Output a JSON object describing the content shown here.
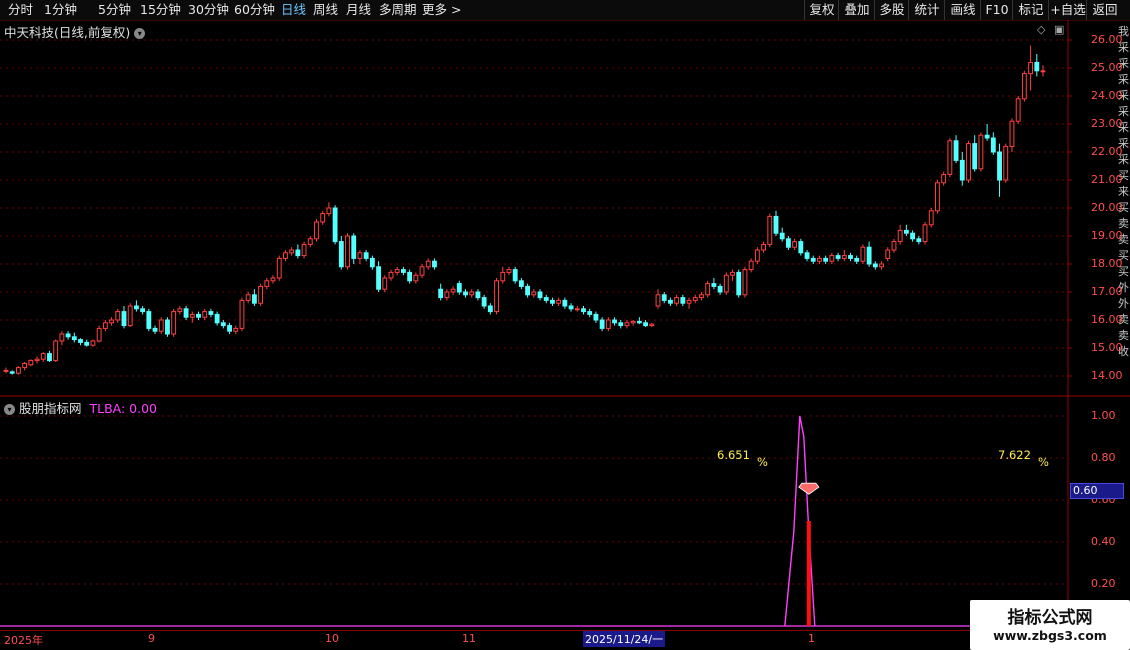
{
  "toolbar": {
    "periods": [
      "分时",
      "1分钟",
      "5分钟",
      "15分钟",
      "30分钟",
      "60分钟",
      "日线",
      "周线",
      "月线",
      "多周期",
      "更多"
    ],
    "active_period": "日线",
    "right_buttons": [
      "复权",
      "叠加",
      "多股",
      "统计",
      "画线",
      "F10",
      "标记",
      "+自选",
      "返回"
    ]
  },
  "main_chart": {
    "title": "中天科技(日线,前复权)",
    "up_color": "#ff4040",
    "down_color": "#54ffff",
    "y_ticks": [
      "26.00",
      "25.00",
      "24.00",
      "23.00",
      "22.00",
      "21.00",
      "20.00",
      "19.00",
      "18.00",
      "17.00",
      "16.00",
      "15.00",
      "14.00"
    ],
    "right_edge_text": "我采采采采采采采采买来买卖卖买买外外卖卖收"
  },
  "indicator": {
    "name": "股朋指标网",
    "value_label": "TLBA: 0.00",
    "y_ticks": [
      "1.00",
      "0.80",
      "0.60",
      "0.40",
      "0.20"
    ],
    "current_value": "0.60",
    "signals": [
      {
        "date_index": 128,
        "pct": "6.651"
      },
      {
        "date_index": 190,
        "pct": "7.622"
      }
    ],
    "pct_symbol": "%",
    "line_color": "#ff40ff",
    "bar_color": "#ff1010"
  },
  "x_axis": {
    "labels": [
      "2025年",
      "9",
      "10",
      "11",
      "2025/11/24/一",
      "1"
    ],
    "cursor_label": "2025/11/24/一"
  },
  "watermark": {
    "line1": "指标公式网",
    "line2": "www.zbgs3.com"
  },
  "chart_data": {
    "type": "candlestick",
    "y_range": [
      13.6,
      26.4
    ],
    "candles": [
      [
        14.2,
        14.3,
        14.1,
        14.2
      ],
      [
        14.15,
        14.2,
        14.05,
        14.1
      ],
      [
        14.1,
        14.35,
        14.05,
        14.3
      ],
      [
        14.3,
        14.5,
        14.2,
        14.45
      ],
      [
        14.4,
        14.6,
        14.35,
        14.55
      ],
      [
        14.55,
        14.7,
        14.45,
        14.6
      ],
      [
        14.6,
        14.85,
        14.5,
        14.8
      ],
      [
        14.8,
        14.9,
        14.5,
        14.55
      ],
      [
        14.55,
        15.3,
        14.5,
        15.25
      ],
      [
        15.25,
        15.6,
        15.1,
        15.5
      ],
      [
        15.5,
        15.6,
        15.3,
        15.4
      ],
      [
        15.4,
        15.55,
        15.2,
        15.3
      ],
      [
        15.3,
        15.35,
        15.1,
        15.2
      ],
      [
        15.2,
        15.3,
        15.05,
        15.1
      ],
      [
        15.1,
        15.3,
        15.05,
        15.25
      ],
      [
        15.25,
        15.8,
        15.2,
        15.7
      ],
      [
        15.7,
        16.0,
        15.6,
        15.9
      ],
      [
        15.9,
        16.1,
        15.8,
        16.0
      ],
      [
        16.0,
        16.4,
        15.9,
        16.3
      ],
      [
        16.3,
        16.5,
        15.7,
        15.8
      ],
      [
        15.8,
        16.6,
        15.75,
        16.5
      ],
      [
        16.5,
        16.7,
        16.3,
        16.4
      ],
      [
        16.4,
        16.5,
        16.2,
        16.3
      ],
      [
        16.3,
        16.4,
        15.6,
        15.7
      ],
      [
        15.7,
        15.8,
        15.5,
        15.6
      ],
      [
        15.6,
        16.1,
        15.5,
        16.0
      ],
      [
        16.0,
        16.1,
        15.4,
        15.5
      ],
      [
        15.5,
        16.4,
        15.4,
        16.3
      ],
      [
        16.3,
        16.5,
        16.2,
        16.4
      ],
      [
        16.4,
        16.5,
        16.0,
        16.1
      ],
      [
        16.1,
        16.3,
        15.9,
        16.2
      ],
      [
        16.2,
        16.3,
        16.0,
        16.1
      ],
      [
        16.1,
        16.4,
        16.0,
        16.3
      ],
      [
        16.3,
        16.4,
        16.1,
        16.2
      ],
      [
        16.2,
        16.3,
        15.8,
        15.9
      ],
      [
        15.9,
        16.0,
        15.7,
        15.8
      ],
      [
        15.8,
        15.9,
        15.5,
        15.6
      ],
      [
        15.6,
        15.8,
        15.5,
        15.7
      ],
      [
        15.7,
        16.8,
        15.6,
        16.7
      ],
      [
        16.7,
        17.0,
        16.6,
        16.9
      ],
      [
        16.9,
        17.1,
        16.5,
        16.6
      ],
      [
        16.6,
        17.3,
        16.5,
        17.2
      ],
      [
        17.2,
        17.5,
        17.1,
        17.4
      ],
      [
        17.4,
        17.6,
        17.3,
        17.5
      ],
      [
        17.5,
        18.3,
        17.4,
        18.2
      ],
      [
        18.2,
        18.5,
        18.1,
        18.4
      ],
      [
        18.4,
        18.6,
        18.3,
        18.5
      ],
      [
        18.5,
        18.7,
        18.2,
        18.3
      ],
      [
        18.3,
        18.8,
        18.2,
        18.7
      ],
      [
        18.7,
        19.0,
        18.6,
        18.9
      ],
      [
        18.9,
        19.6,
        18.8,
        19.5
      ],
      [
        19.5,
        19.9,
        19.4,
        19.8
      ],
      [
        19.8,
        20.2,
        19.7,
        20.0
      ],
      [
        20.0,
        20.1,
        18.7,
        18.8
      ],
      [
        18.8,
        19.0,
        17.8,
        17.9
      ],
      [
        17.9,
        19.1,
        17.8,
        19.0
      ],
      [
        19.0,
        19.1,
        18.0,
        18.2
      ],
      [
        18.2,
        18.5,
        18.0,
        18.4
      ],
      [
        18.4,
        18.5,
        18.1,
        18.2
      ],
      [
        18.2,
        18.3,
        17.8,
        17.9
      ],
      [
        17.9,
        18.1,
        17.0,
        17.1
      ],
      [
        17.1,
        17.6,
        17.0,
        17.5
      ],
      [
        17.5,
        17.8,
        17.4,
        17.7
      ],
      [
        17.7,
        17.9,
        17.6,
        17.8
      ],
      [
        17.8,
        17.9,
        17.6,
        17.7
      ],
      [
        17.7,
        17.8,
        17.3,
        17.4
      ],
      [
        17.4,
        17.7,
        17.3,
        17.6
      ],
      [
        17.6,
        18.0,
        17.5,
        17.9
      ],
      [
        17.9,
        18.2,
        17.8,
        18.1
      ],
      [
        18.1,
        18.2,
        17.8,
        17.9
      ],
      [
        17.1,
        17.3,
        16.7,
        16.8
      ],
      [
        16.8,
        17.1,
        16.7,
        17.0
      ],
      [
        17.0,
        17.2,
        16.9,
        17.1
      ],
      [
        17.3,
        17.4,
        16.9,
        17.0
      ],
      [
        17.0,
        17.1,
        16.8,
        16.9
      ],
      [
        16.9,
        17.1,
        16.8,
        17.0
      ],
      [
        17.0,
        17.1,
        16.7,
        16.8
      ],
      [
        16.8,
        16.9,
        16.4,
        16.5
      ],
      [
        16.5,
        16.6,
        16.2,
        16.3
      ],
      [
        16.3,
        17.5,
        16.2,
        17.4
      ],
      [
        17.4,
        17.9,
        17.3,
        17.7
      ],
      [
        17.7,
        17.9,
        17.6,
        17.8
      ],
      [
        17.8,
        17.9,
        17.3,
        17.4
      ],
      [
        17.4,
        17.5,
        17.1,
        17.2
      ],
      [
        17.2,
        17.3,
        16.8,
        16.9
      ],
      [
        16.9,
        17.1,
        16.8,
        17.0
      ],
      [
        17.0,
        17.1,
        16.7,
        16.8
      ],
      [
        16.8,
        16.9,
        16.6,
        16.7
      ],
      [
        16.7,
        16.8,
        16.5,
        16.6
      ],
      [
        16.6,
        16.8,
        16.5,
        16.7
      ],
      [
        16.7,
        16.8,
        16.4,
        16.5
      ],
      [
        16.5,
        16.6,
        16.3,
        16.4
      ],
      [
        16.4,
        16.5,
        16.3,
        16.4
      ],
      [
        16.4,
        16.5,
        16.2,
        16.3
      ],
      [
        16.3,
        16.4,
        16.1,
        16.2
      ],
      [
        16.2,
        16.3,
        15.9,
        16.0
      ],
      [
        16.0,
        16.1,
        15.6,
        15.7
      ],
      [
        15.7,
        16.1,
        15.6,
        16.0
      ],
      [
        16.0,
        16.1,
        15.8,
        15.9
      ],
      [
        15.9,
        16.0,
        15.7,
        15.8
      ],
      [
        15.8,
        16.0,
        15.7,
        15.9
      ],
      [
        15.9,
        16.0,
        15.8,
        15.95
      ],
      [
        15.95,
        16.1,
        15.85,
        15.9
      ],
      [
        15.9,
        16.0,
        15.75,
        15.8
      ],
      [
        15.8,
        15.9,
        15.75,
        15.85
      ],
      [
        16.5,
        17.1,
        16.4,
        16.9
      ],
      [
        16.9,
        17.0,
        16.6,
        16.7
      ],
      [
        16.7,
        16.8,
        16.5,
        16.6
      ],
      [
        16.6,
        16.9,
        16.5,
        16.8
      ],
      [
        16.8,
        16.9,
        16.5,
        16.6
      ],
      [
        16.6,
        16.8,
        16.4,
        16.7
      ],
      [
        16.7,
        16.9,
        16.6,
        16.8
      ],
      [
        16.8,
        17.0,
        16.7,
        16.9
      ],
      [
        16.9,
        17.4,
        16.8,
        17.3
      ],
      [
        17.3,
        17.5,
        17.1,
        17.2
      ],
      [
        17.2,
        17.3,
        16.9,
        17.0
      ],
      [
        17.0,
        17.7,
        16.9,
        17.6
      ],
      [
        17.6,
        17.8,
        17.4,
        17.7
      ],
      [
        17.7,
        17.8,
        16.8,
        16.9
      ],
      [
        16.9,
        17.9,
        16.8,
        17.8
      ],
      [
        17.8,
        18.2,
        17.7,
        18.1
      ],
      [
        18.1,
        18.6,
        18.0,
        18.5
      ],
      [
        18.5,
        18.8,
        18.4,
        18.7
      ],
      [
        18.7,
        19.8,
        18.6,
        19.7
      ],
      [
        19.7,
        19.9,
        19.0,
        19.1
      ],
      [
        19.1,
        19.3,
        18.8,
        18.9
      ],
      [
        18.9,
        19.0,
        18.5,
        18.6
      ],
      [
        18.6,
        18.9,
        18.5,
        18.8
      ],
      [
        18.8,
        18.9,
        18.3,
        18.4
      ],
      [
        18.4,
        18.5,
        18.1,
        18.2
      ],
      [
        18.2,
        18.3,
        18.0,
        18.1
      ],
      [
        18.1,
        18.3,
        18.0,
        18.2
      ],
      [
        18.2,
        18.3,
        18.0,
        18.1
      ],
      [
        18.1,
        18.4,
        18.0,
        18.3
      ],
      [
        18.3,
        18.4,
        18.1,
        18.2
      ],
      [
        18.2,
        18.5,
        18.1,
        18.3
      ],
      [
        18.3,
        18.4,
        18.1,
        18.2
      ],
      [
        18.2,
        18.3,
        18.0,
        18.1
      ],
      [
        18.1,
        18.7,
        18.0,
        18.6
      ],
      [
        18.6,
        18.8,
        17.9,
        18.0
      ],
      [
        18.0,
        18.1,
        17.8,
        17.9
      ],
      [
        17.9,
        18.1,
        17.8,
        18.0
      ],
      [
        18.2,
        18.6,
        18.1,
        18.5
      ],
      [
        18.5,
        18.9,
        18.4,
        18.8
      ],
      [
        18.8,
        19.4,
        18.7,
        19.2
      ],
      [
        19.2,
        19.4,
        19.0,
        19.1
      ],
      [
        19.1,
        19.2,
        18.8,
        18.9
      ],
      [
        18.9,
        19.0,
        18.7,
        18.8
      ],
      [
        18.8,
        19.5,
        18.7,
        19.4
      ],
      [
        19.4,
        20.0,
        19.3,
        19.9
      ],
      [
        19.9,
        21.0,
        19.8,
        20.9
      ],
      [
        20.9,
        21.3,
        20.8,
        21.2
      ],
      [
        21.2,
        22.5,
        21.1,
        22.4
      ],
      [
        22.4,
        22.6,
        21.6,
        21.7
      ],
      [
        21.7,
        22.0,
        20.8,
        21.0
      ],
      [
        21.0,
        22.4,
        20.9,
        22.3
      ],
      [
        22.3,
        22.6,
        21.3,
        21.4
      ],
      [
        21.4,
        22.7,
        21.3,
        22.6
      ],
      [
        22.6,
        23.0,
        22.4,
        22.5
      ],
      [
        22.5,
        22.7,
        21.9,
        22.0
      ],
      [
        22.0,
        22.3,
        20.4,
        21.0
      ],
      [
        21.0,
        22.3,
        20.9,
        22.2
      ],
      [
        22.2,
        23.2,
        22.0,
        23.1
      ],
      [
        23.1,
        24.0,
        23.0,
        23.9
      ],
      [
        23.9,
        24.9,
        23.8,
        24.8
      ],
      [
        24.8,
        25.8,
        24.2,
        25.2
      ],
      [
        25.2,
        25.5,
        24.7,
        24.9
      ],
      [
        24.9,
        25.1,
        24.7,
        24.9
      ]
    ],
    "tlba_series_indices": {
      "spike1": 128,
      "spike2": 190
    }
  }
}
